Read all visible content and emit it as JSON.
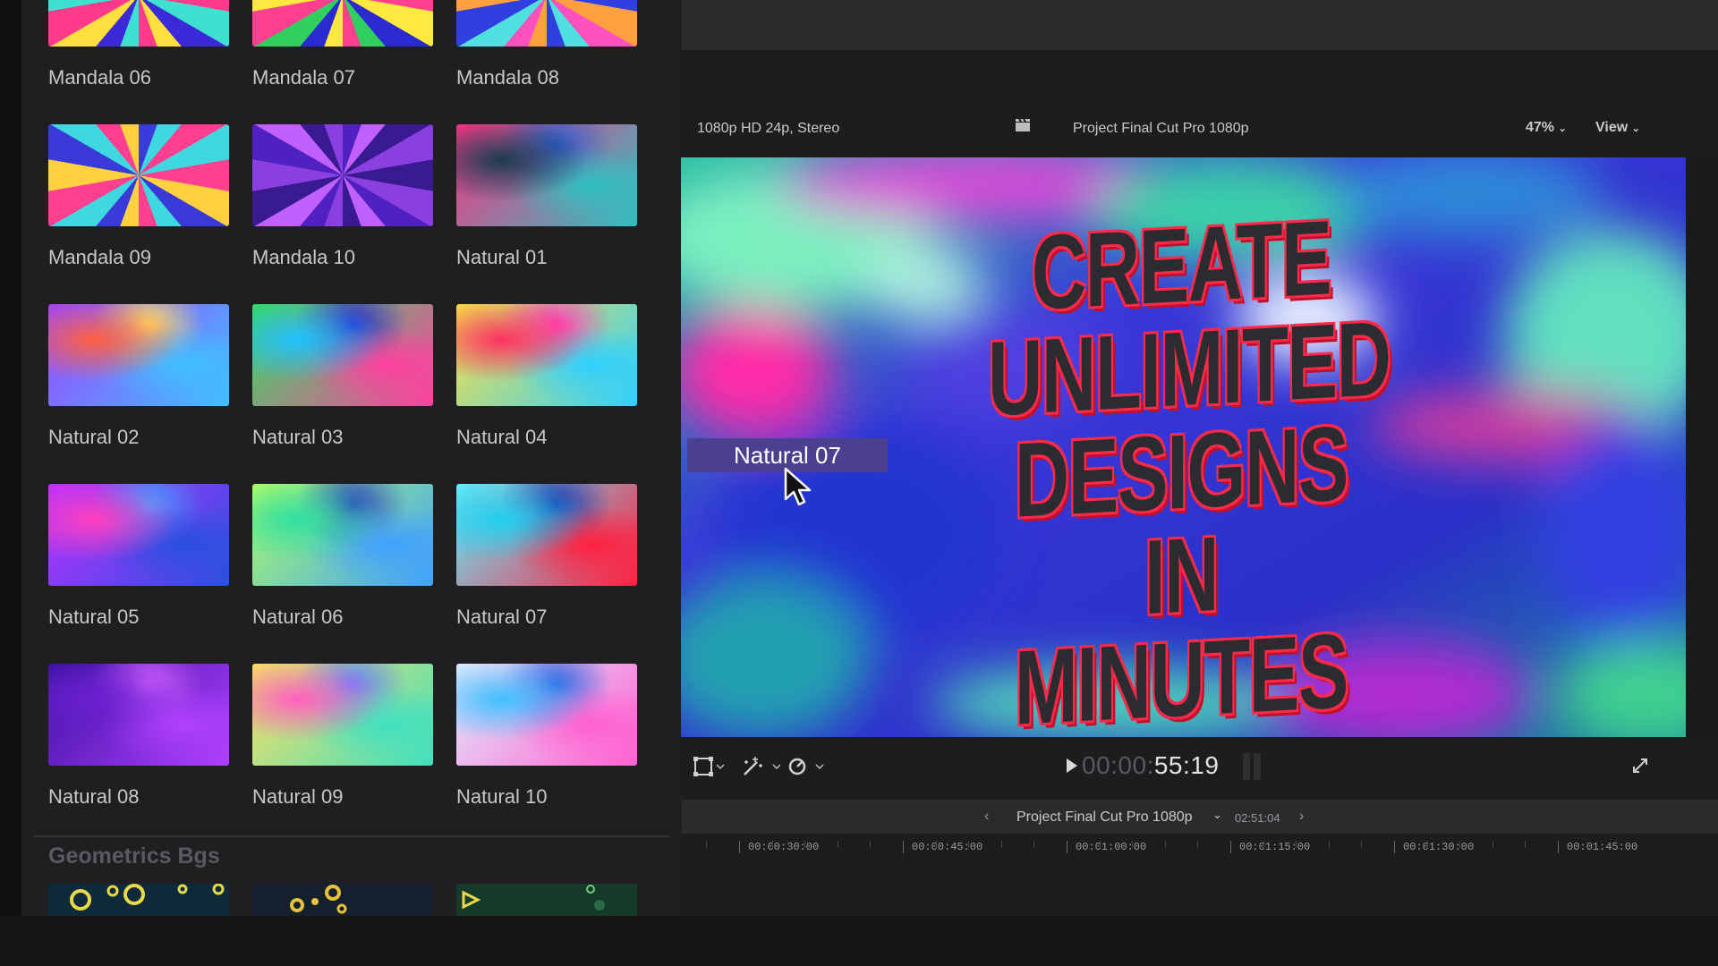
{
  "browser": {
    "tiles": [
      {
        "label": "Mandala 06"
      },
      {
        "label": "Mandala 07"
      },
      {
        "label": "Mandala 08"
      },
      {
        "label": "Mandala 09"
      },
      {
        "label": "Mandala 10"
      },
      {
        "label": "Natural 01"
      },
      {
        "label": "Natural 02"
      },
      {
        "label": "Natural 03"
      },
      {
        "label": "Natural 04"
      },
      {
        "label": "Natural 05"
      },
      {
        "label": "Natural 06"
      },
      {
        "label": "Natural 07"
      },
      {
        "label": "Natural 08"
      },
      {
        "label": "Natural 09"
      },
      {
        "label": "Natural 10"
      }
    ],
    "section_header": "Geometrics Bgs"
  },
  "viewer": {
    "format": "1080p HD 24p, Stereo",
    "project_name": "Project Final Cut Pro 1080p",
    "zoom": "47%",
    "view_menu": "View",
    "canvas_title_lines": [
      "CREATE",
      "UNLIMITED",
      "DESIGNS",
      "IN MINUTES"
    ],
    "drag_tooltip": "Natural 07",
    "timecode_dim": "00:00:",
    "timecode_bright": "55:19"
  },
  "timeline": {
    "project_name": "Project Final Cut Pro 1080p",
    "duration": "02:51:04",
    "ruler_labels": [
      "00:00:30:00",
      "00:00:45:00",
      "00:01:00:00",
      "00:01:15:00",
      "00:01:30:00",
      "00:01:45:00"
    ]
  },
  "colors": {
    "accent_tooltip": "#4b3f8f",
    "title_outline": "#ff2a4a"
  }
}
